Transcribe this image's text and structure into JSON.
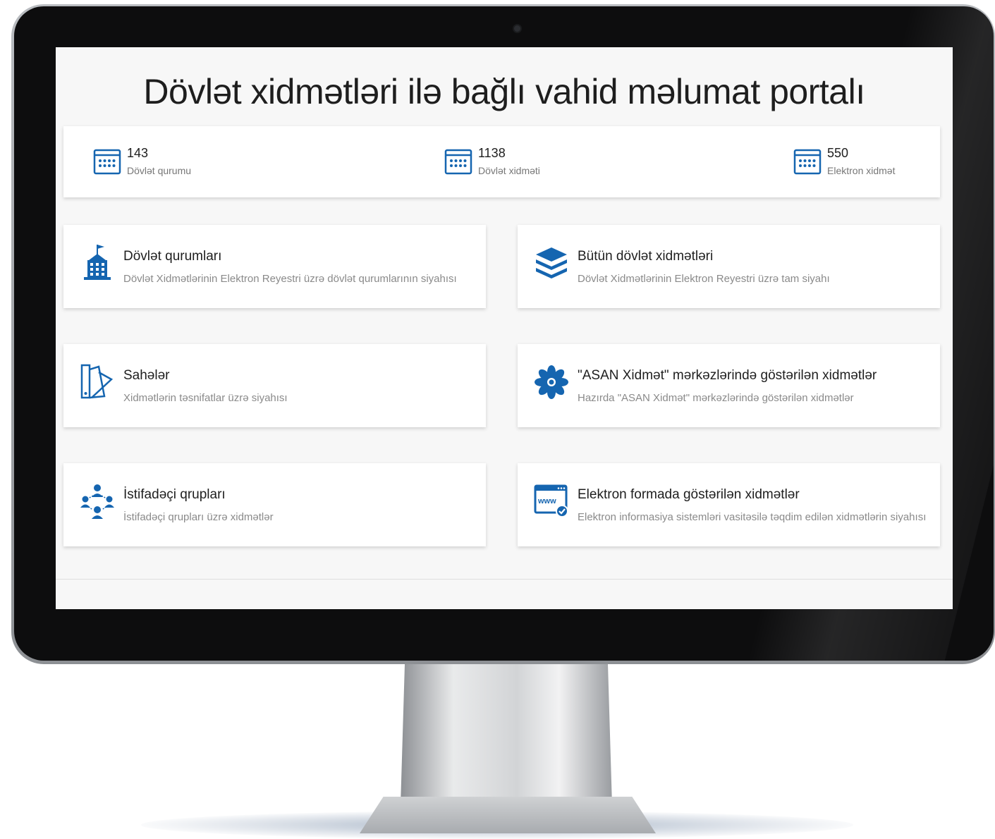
{
  "page": {
    "title": "Dövlət xidmətləri ilə bağlı vahid məlumat portalı"
  },
  "stats": [
    {
      "value": "143",
      "label": "Dövlət qurumu",
      "icon": "calendar-icon"
    },
    {
      "value": "1138",
      "label": "Dövlət xidməti",
      "icon": "calendar-icon"
    },
    {
      "value": "550",
      "label": "Elektron xidmət",
      "icon": "calendar-icon"
    }
  ],
  "cards": [
    {
      "title": "Dövlət qurumları",
      "subtitle": "Dövlət Xidmətlərinin Elektron Reyestri üzrə dövlət qurumlarının siyahısı",
      "icon": "government-building-icon"
    },
    {
      "title": "Bütün dövlət xidmətləri",
      "subtitle": "Dövlət Xidmətlərinin Elektron Reyestri üzrə tam siyahı",
      "icon": "layers-stack-icon"
    },
    {
      "title": "Sahələr",
      "subtitle": "Xidmətlərin təsnifatlar üzrə siyahısı",
      "icon": "swatch-fan-icon"
    },
    {
      "title": "\"ASAN Xidmət\" mərkəzlərində göstərilən xidmətlər",
      "subtitle": "Hazırda \"ASAN Xidmət\" mərkəzlərində göstərilən xidmətlər",
      "icon": "asan-flower-icon"
    },
    {
      "title": "İstifadəçi qrupları",
      "subtitle": "İstifadəçi qrupları üzrə xidmətlər",
      "icon": "user-group-icon"
    },
    {
      "title": "Elektron formada göstərilən xidmətlər",
      "subtitle": "Elektron informasiya sistemləri vasitəsilə təqdim edilən xidmətlərin siyahısı",
      "icon": "www-browser-icon"
    }
  ],
  "colors": {
    "accent": "#1565b0",
    "text": "#1e1e1e",
    "muted": "#8a8a8a",
    "screen_bg": "#f7f7f7"
  }
}
